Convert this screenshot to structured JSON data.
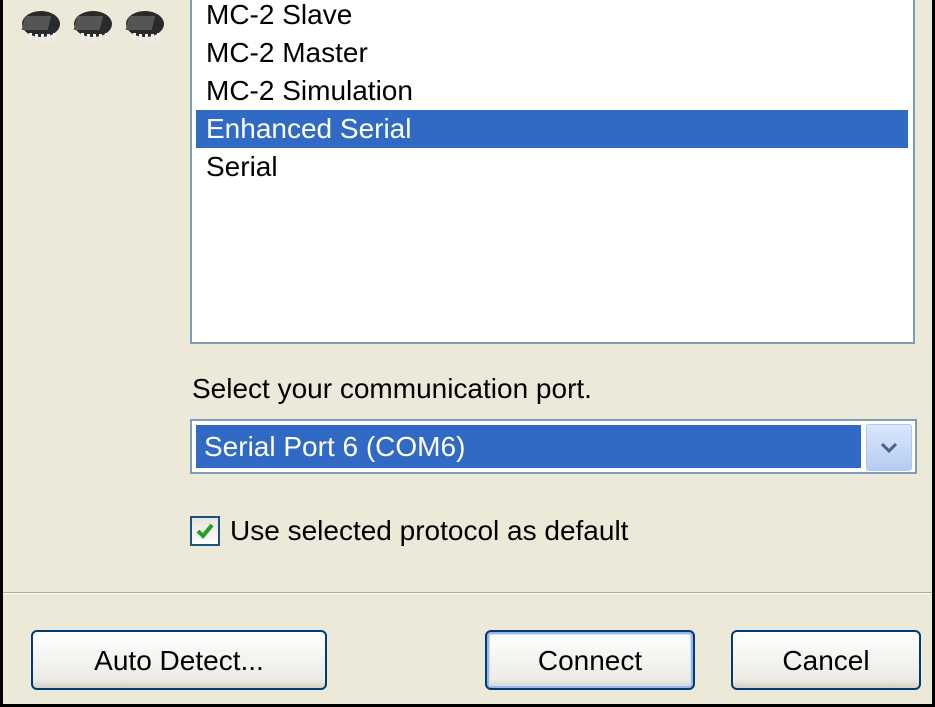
{
  "protocols": {
    "items": [
      {
        "label": "MC-2 Slave",
        "selected": false
      },
      {
        "label": "MC-2 Master",
        "selected": false
      },
      {
        "label": "MC-2 Simulation",
        "selected": false
      },
      {
        "label": "Enhanced Serial",
        "selected": true
      },
      {
        "label": "Serial",
        "selected": false
      }
    ]
  },
  "port": {
    "label": "Select your communication port.",
    "selected_value": "Serial Port 6 (COM6)"
  },
  "default_option": {
    "label": "Use selected protocol as default",
    "checked": true
  },
  "buttons": {
    "auto_detect": "Auto Detect...",
    "connect": "Connect",
    "cancel": "Cancel"
  },
  "icons": {
    "chip_icons": [
      "chip-icon",
      "chip-icon",
      "chip-icon"
    ],
    "dropdown": "chevron-down-icon",
    "check": "checkmark-icon"
  },
  "colors": {
    "selection": "#316ac5",
    "dialog_bg": "#ece9d8",
    "border": "#7f9db9",
    "button_border": "#003c74"
  }
}
